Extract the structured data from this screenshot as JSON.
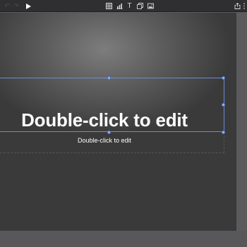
{
  "toolbar": {
    "undo_icon": "undo-icon",
    "redo_icon": "redo-icon",
    "play_icon": "play-icon",
    "insert": [
      "table-icon",
      "chart-icon",
      "text-icon",
      "shape-icon",
      "media-icon"
    ],
    "share_icon": "share-icon",
    "more_icon": "more-icon",
    "text_glyph": "T"
  },
  "slide": {
    "title": "Double-click to edit",
    "subtitle": "Double-click to edit"
  },
  "colors": {
    "toolbar_bg": "#2f2f31",
    "selection": "#6d8bd6",
    "handle": "#9ab8f0"
  }
}
